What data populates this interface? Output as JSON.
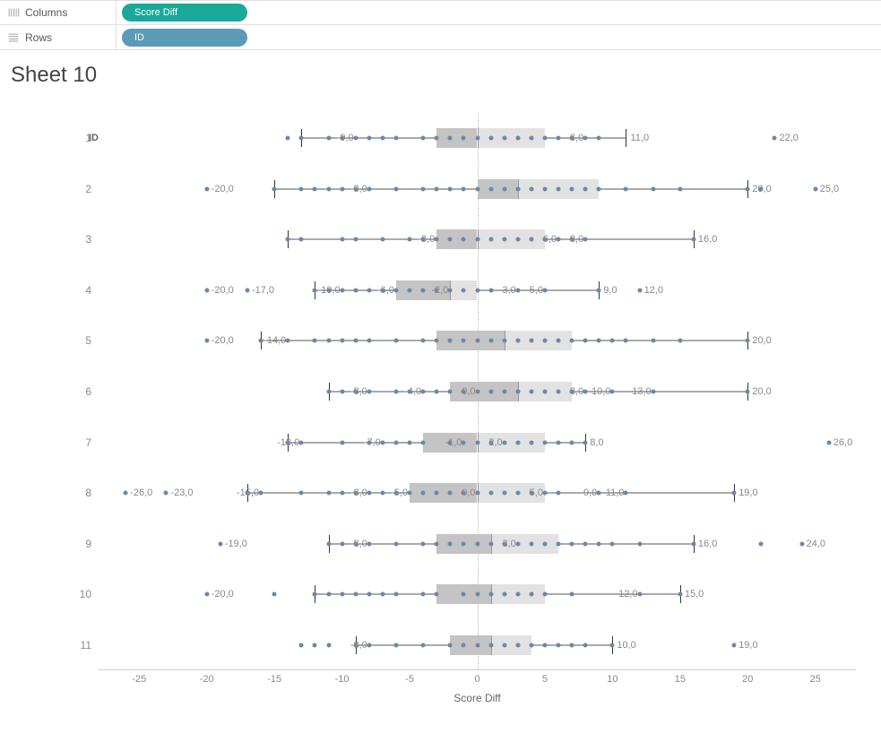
{
  "shelves": {
    "columns_label": "Columns",
    "rows_label": "Rows",
    "columns_pill": "Score Diff",
    "rows_pill": "ID"
  },
  "title": "Sheet 10",
  "row_header": "ID",
  "x_label": "Score Diff",
  "x_min": -28,
  "x_max": 28,
  "x_ticks": [
    -25,
    -20,
    -15,
    -10,
    -5,
    0,
    5,
    10,
    15,
    20,
    25
  ],
  "row_ids": [
    "1",
    "2",
    "3",
    "4",
    "5",
    "6",
    "7",
    "8",
    "9",
    "10",
    "11"
  ],
  "chart_data": {
    "type": "boxplot",
    "title": "Sheet 10",
    "xlabel": "Score Diff",
    "ylabel": "ID",
    "xlim": [
      -28,
      28
    ],
    "series": [
      {
        "id": "1",
        "lw": -13,
        "q1": -3,
        "med": 0,
        "q3": 5,
        "uw": 11,
        "points": [
          -14,
          -13,
          -11,
          -10,
          -9,
          -8,
          -7,
          -6,
          -4,
          -3,
          -2,
          -1,
          0,
          1,
          2,
          3,
          4,
          5,
          6,
          7,
          8,
          9,
          22
        ],
        "labels": [
          {
            "x": -9,
            "t": "-9,0"
          },
          {
            "x": 8,
            "t": "8,0"
          },
          {
            "x": 11,
            "t": "11,0",
            "side": "right"
          },
          {
            "x": 22,
            "t": "22,0",
            "side": "right"
          }
        ]
      },
      {
        "id": "2",
        "lw": -15,
        "q1": 0,
        "med": 3,
        "q3": 9,
        "uw": 20,
        "points": [
          -20,
          -15,
          -13,
          -12,
          -11,
          -10,
          -9,
          -8,
          -6,
          -4,
          -3,
          -2,
          -1,
          0,
          1,
          2,
          3,
          4,
          5,
          6,
          7,
          8,
          9,
          11,
          13,
          15,
          20,
          21,
          25
        ],
        "labels": [
          {
            "x": -20,
            "t": "-20,0",
            "side": "right"
          },
          {
            "x": -8,
            "t": "-8,0"
          },
          {
            "x": 20,
            "t": "20,0",
            "side": "right"
          },
          {
            "x": 25,
            "t": "25,0",
            "side": "right"
          }
        ]
      },
      {
        "id": "3",
        "lw": -14,
        "q1": -3,
        "med": 0,
        "q3": 5,
        "uw": 16,
        "points": [
          -14,
          -13,
          -10,
          -9,
          -7,
          -5,
          -4,
          -3,
          -2,
          -1,
          0,
          1,
          2,
          3,
          4,
          5,
          6,
          7,
          8,
          16
        ],
        "labels": [
          {
            "x": -3,
            "t": "-3,0"
          },
          {
            "x": 6,
            "t": "6,0"
          },
          {
            "x": 8,
            "t": "8,0"
          },
          {
            "x": 16,
            "t": "16,0",
            "side": "right"
          }
        ]
      },
      {
        "id": "4",
        "lw": -12,
        "q1": -6,
        "med": -2,
        "q3": 0,
        "uw": 9,
        "points": [
          -20,
          -17,
          -12,
          -11,
          -10,
          -9,
          -8,
          -7,
          -6,
          -5,
          -4,
          -3,
          -2,
          -1,
          0,
          1,
          3,
          5,
          9,
          12
        ],
        "labels": [
          {
            "x": -20,
            "t": "-20,0",
            "side": "right"
          },
          {
            "x": -17,
            "t": "-17,0",
            "side": "right"
          },
          {
            "x": -10,
            "t": "-10,0"
          },
          {
            "x": -6,
            "t": "-6,0"
          },
          {
            "x": -2,
            "t": "-2,0"
          },
          {
            "x": 3,
            "t": "3,0"
          },
          {
            "x": 5,
            "t": "5,0"
          },
          {
            "x": 9,
            "t": "9,0",
            "side": "right"
          },
          {
            "x": 12,
            "t": "12,0",
            "side": "right"
          }
        ]
      },
      {
        "id": "5",
        "lw": -16,
        "q1": -3,
        "med": 2,
        "q3": 7,
        "uw": 20,
        "points": [
          -20,
          -16,
          -14,
          -12,
          -11,
          -10,
          -9,
          -8,
          -6,
          -4,
          -3,
          -2,
          -1,
          0,
          1,
          2,
          3,
          4,
          5,
          6,
          7,
          8,
          9,
          10,
          11,
          13,
          15,
          20
        ],
        "labels": [
          {
            "x": -20,
            "t": "-20,0",
            "side": "right"
          },
          {
            "x": -14,
            "t": "-14,0"
          },
          {
            "x": 20,
            "t": "20,0",
            "side": "right"
          }
        ]
      },
      {
        "id": "6",
        "lw": -11,
        "q1": -2,
        "med": 3,
        "q3": 7,
        "uw": 20,
        "points": [
          -11,
          -10,
          -9,
          -8,
          -6,
          -5,
          -4,
          -3,
          -2,
          -1,
          0,
          1,
          2,
          3,
          4,
          5,
          6,
          7,
          8,
          10,
          13,
          20
        ],
        "labels": [
          {
            "x": -8,
            "t": "-8,0"
          },
          {
            "x": -4,
            "t": "-4,0"
          },
          {
            "x": 0,
            "t": "0,0"
          },
          {
            "x": 8,
            "t": "8,0"
          },
          {
            "x": 10,
            "t": "10,0"
          },
          {
            "x": 13,
            "t": "13,0"
          },
          {
            "x": 20,
            "t": "20,0",
            "side": "right"
          }
        ]
      },
      {
        "id": "7",
        "lw": -14,
        "q1": -4,
        "med": 0,
        "q3": 5,
        "uw": 8,
        "points": [
          -14,
          -13,
          -10,
          -8,
          -7,
          -6,
          -5,
          -4,
          -2,
          -1,
          0,
          1,
          2,
          3,
          4,
          5,
          6,
          7,
          8,
          26
        ],
        "labels": [
          {
            "x": -13,
            "t": "-13,0"
          },
          {
            "x": -7,
            "t": "-7,0"
          },
          {
            "x": -1,
            "t": "-1,0"
          },
          {
            "x": 2,
            "t": "2,0"
          },
          {
            "x": 8,
            "t": "8,0",
            "side": "right"
          },
          {
            "x": 26,
            "t": "26,0",
            "side": "right"
          }
        ]
      },
      {
        "id": "8",
        "lw": -17,
        "q1": -5,
        "med": 0,
        "q3": 5,
        "uw": 19,
        "points": [
          -26,
          -23,
          -17,
          -16,
          -13,
          -11,
          -10,
          -9,
          -8,
          -7,
          -6,
          -5,
          -4,
          -3,
          -2,
          -1,
          0,
          1,
          2,
          3,
          4,
          5,
          6,
          9,
          11,
          19
        ],
        "labels": [
          {
            "x": -26,
            "t": "-26,0",
            "side": "right"
          },
          {
            "x": -23,
            "t": "-23,0",
            "side": "right"
          },
          {
            "x": -16,
            "t": "-16,0"
          },
          {
            "x": -8,
            "t": "-8,0"
          },
          {
            "x": -5,
            "t": "-5,0"
          },
          {
            "x": 0,
            "t": "0,0"
          },
          {
            "x": 5,
            "t": "5,0"
          },
          {
            "x": 9,
            "t": "9,0"
          },
          {
            "x": 11,
            "t": "11,0"
          },
          {
            "x": 19,
            "t": "19,0",
            "side": "right"
          }
        ]
      },
      {
        "id": "9",
        "lw": -11,
        "q1": -3,
        "med": 1,
        "q3": 6,
        "uw": 16,
        "points": [
          -19,
          -11,
          -10,
          -9,
          -8,
          -6,
          -4,
          -3,
          -2,
          -1,
          0,
          1,
          2,
          3,
          4,
          5,
          6,
          7,
          8,
          9,
          10,
          12,
          16,
          21,
          24
        ],
        "labels": [
          {
            "x": -19,
            "t": "-19,0",
            "side": "right"
          },
          {
            "x": -8,
            "t": "-8,0"
          },
          {
            "x": 3,
            "t": "3,0"
          },
          {
            "x": 16,
            "t": "16,0",
            "side": "right"
          },
          {
            "x": 24,
            "t": "24,0",
            "side": "right"
          }
        ]
      },
      {
        "id": "10",
        "lw": -12,
        "q1": -3,
        "med": 1,
        "q3": 5,
        "uw": 15,
        "points": [
          -20,
          -15,
          -12,
          -11,
          -10,
          -9,
          -8,
          -7,
          -6,
          -4,
          -3,
          -1,
          0,
          1,
          2,
          3,
          4,
          5,
          7,
          12,
          15
        ],
        "labels": [
          {
            "x": -20,
            "t": "-20,0",
            "side": "right"
          },
          {
            "x": 12,
            "t": "12,0"
          },
          {
            "x": 15,
            "t": "15,0",
            "side": "right"
          }
        ]
      },
      {
        "id": "11",
        "lw": -9,
        "q1": -2,
        "med": 1,
        "q3": 4,
        "uw": 10,
        "points": [
          -13,
          -12,
          -11,
          -9,
          -8,
          -6,
          -4,
          -2,
          -1,
          0,
          1,
          2,
          3,
          4,
          5,
          6,
          7,
          8,
          10,
          19
        ],
        "labels": [
          {
            "x": -8,
            "t": "-8,0"
          },
          {
            "x": 10,
            "t": "10,0",
            "side": "right"
          },
          {
            "x": 19,
            "t": "19,0",
            "side": "right"
          }
        ]
      }
    ]
  }
}
